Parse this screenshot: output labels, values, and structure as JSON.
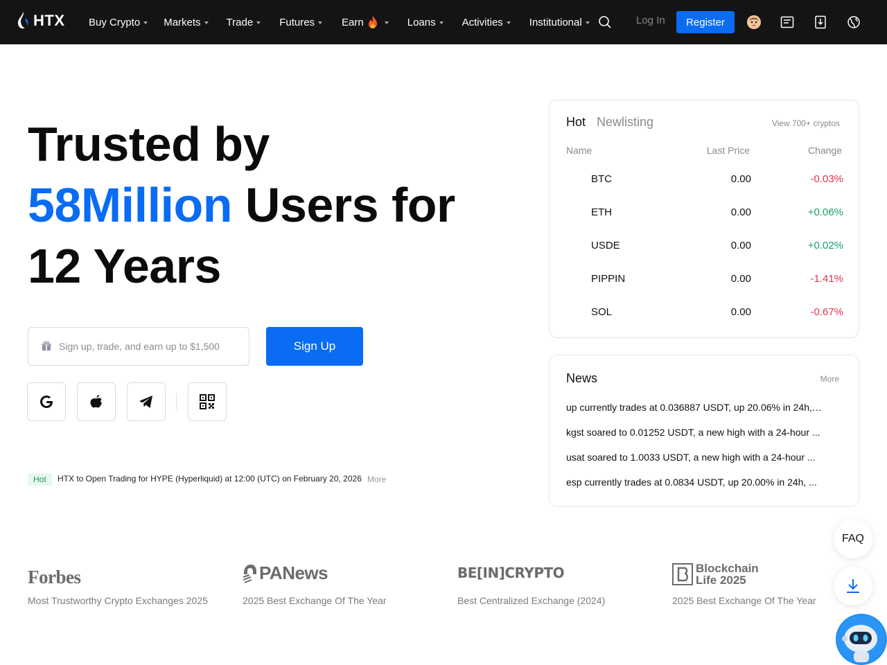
{
  "brand": {
    "name": "HTX",
    "accent": "#0a6cf2"
  },
  "nav": {
    "items": [
      {
        "label": "Buy Crypto",
        "has_caret": true
      },
      {
        "label": "Markets",
        "has_caret": true
      },
      {
        "label": "Trade",
        "has_caret": true
      },
      {
        "label": "Futures",
        "has_caret": true
      },
      {
        "label": "Earn",
        "has_caret": true,
        "icon": "fire-icon"
      },
      {
        "label": "Loans",
        "has_caret": true
      },
      {
        "label": "Activities",
        "has_caret": true
      },
      {
        "label": "Institutional",
        "has_caret": true
      }
    ],
    "login_label": "Log In",
    "register_label": "Register",
    "icons": [
      "search-icon",
      "avatar-icon",
      "orders-icon",
      "download-icon",
      "language-icon"
    ]
  },
  "hero": {
    "title_line1": "Trusted by",
    "title_highlight": "58Million",
    "title_line2_rest": " Users for",
    "title_line3": "12 Years",
    "input_placeholder": "Sign up, trade, and earn up to $1,500",
    "signup_label": "Sign Up",
    "social": [
      "google-icon",
      "apple-icon",
      "telegram-icon",
      "qr-code-icon"
    ]
  },
  "announcement": {
    "badge": "Hot",
    "text": "HTX to Open Trading for HYPE (Hyperliquid) at 12:00 (UTC)  on February 20, 2026",
    "more": "More"
  },
  "market": {
    "tab_hot": "Hot",
    "tab_new": "Newlisting",
    "view_all": "View 700+ cryptos",
    "col_name": "Name",
    "col_price": "Last Price",
    "col_change": "Change",
    "rows": [
      {
        "name": "BTC",
        "price": "0.00",
        "change": "-0.03%",
        "dir": "neg"
      },
      {
        "name": "ETH",
        "price": "0.00",
        "change": "+0.06%",
        "dir": "pos"
      },
      {
        "name": "USDE",
        "price": "0.00",
        "change": "+0.02%",
        "dir": "pos"
      },
      {
        "name": "PIPPIN",
        "price": "0.00",
        "change": "-1.41%",
        "dir": "neg"
      },
      {
        "name": "SOL",
        "price": "0.00",
        "change": "-0.67%",
        "dir": "neg"
      }
    ]
  },
  "news": {
    "title": "News",
    "more": "More",
    "items": [
      "up currently trades at 0.036887 USDT, up 20.06% in 24h, ...",
      "kgst soared to 0.01252 USDT, a new high with a 24-hour ...",
      "usat soared to 1.0033 USDT, a new high with a 24-hour ...",
      "esp currently trades at 0.0834 USDT, up 20.00% in 24h, ..."
    ]
  },
  "awards": [
    {
      "logo": "Forbes",
      "text": "Most Trustworthy Crypto Exchanges 2025"
    },
    {
      "logo": "PANews",
      "text": "2025 Best Exchange Of The Year"
    },
    {
      "logo": "BE[IN]CRYPTO",
      "text": "Best Centralized Exchange (2024)"
    },
    {
      "logo": "Blockchain Life 2025",
      "text": "2025 Best Exchange Of The Year"
    }
  ],
  "floating": {
    "faq_label": "FAQ"
  }
}
